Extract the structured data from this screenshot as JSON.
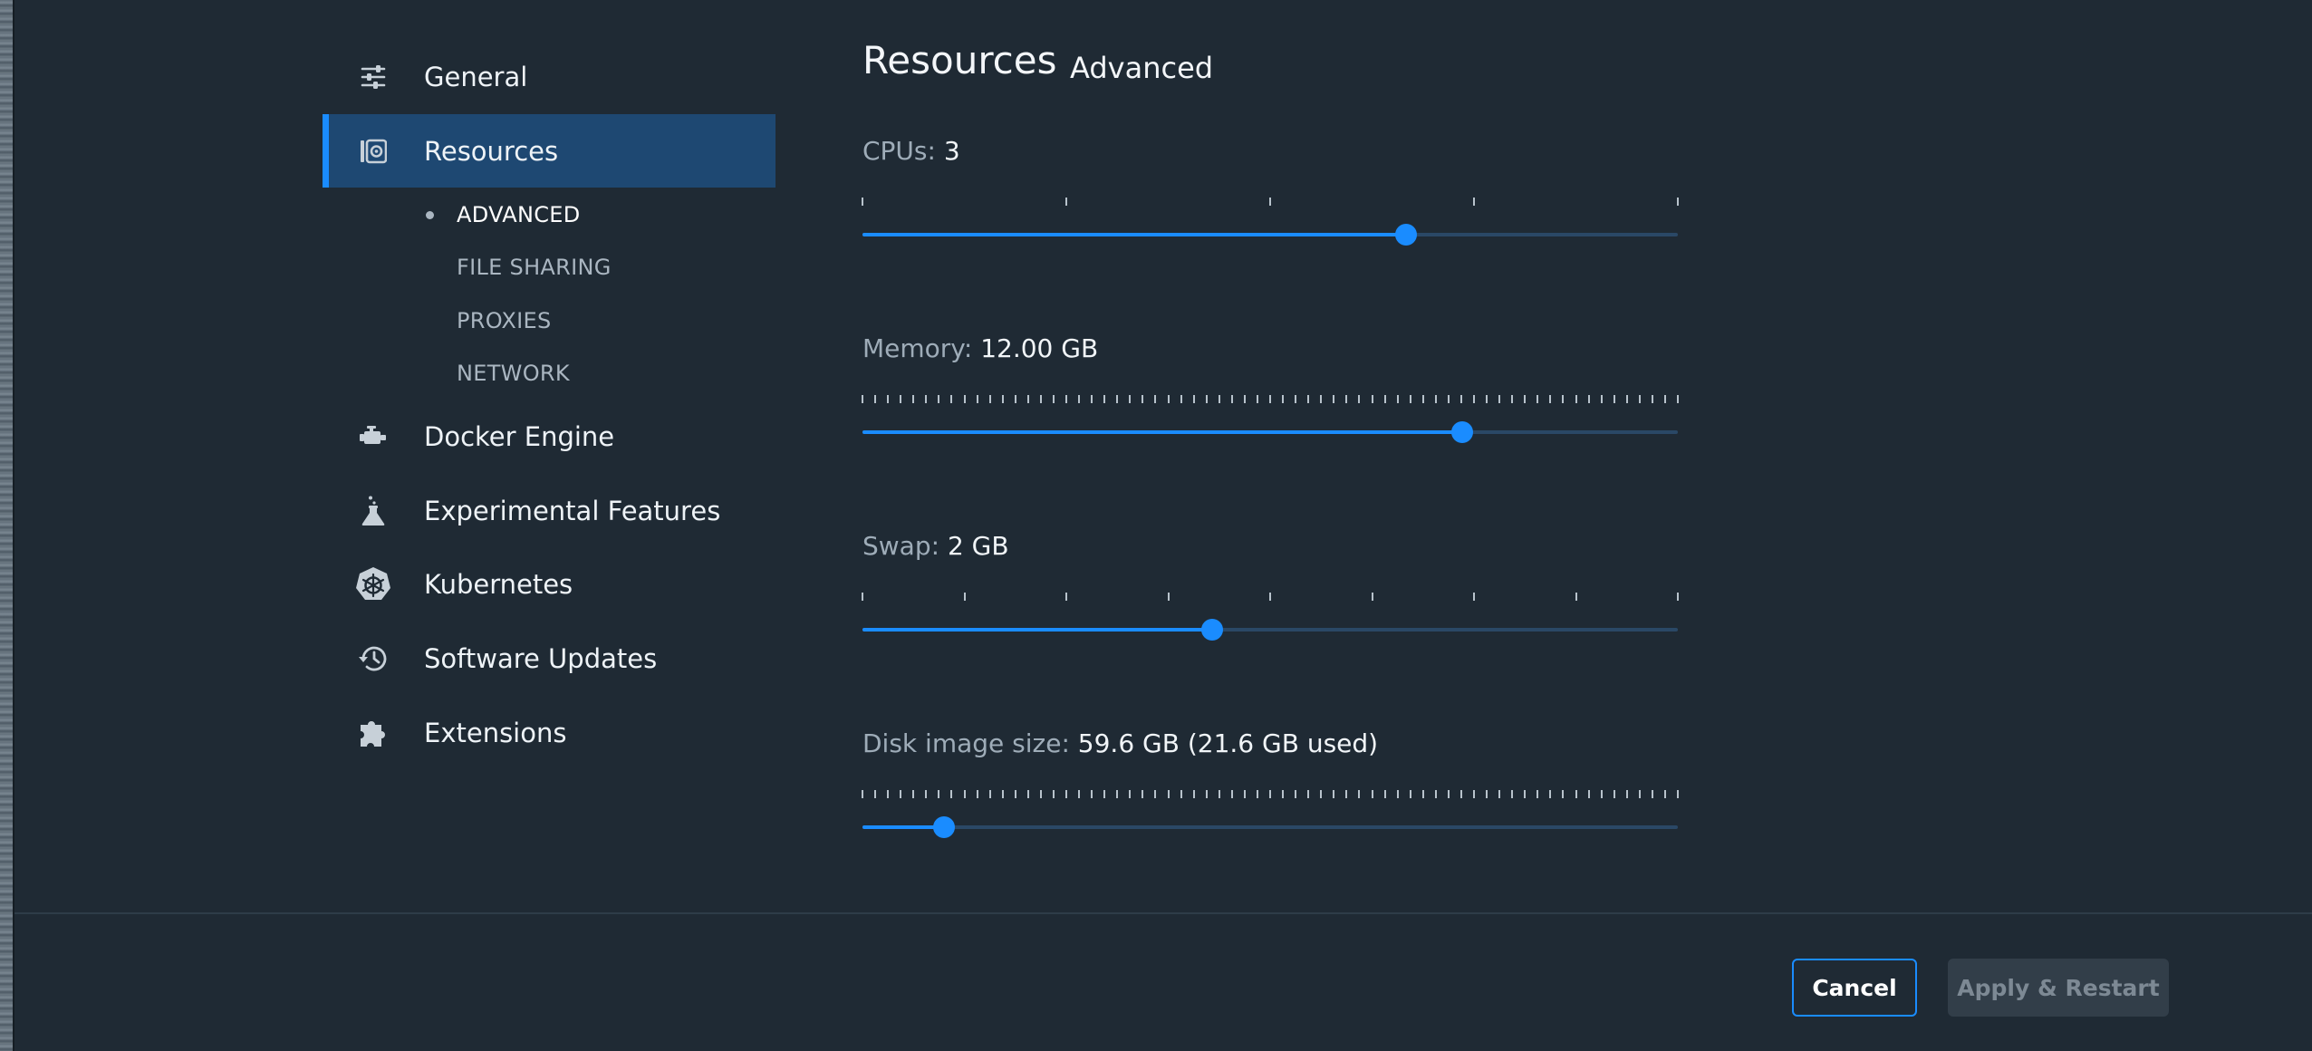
{
  "sidebar": {
    "items": [
      {
        "label": "General",
        "icon": "sliders-icon"
      },
      {
        "label": "Resources",
        "icon": "resources-icon",
        "active": true
      },
      {
        "label": "Docker Engine",
        "icon": "engine-icon"
      },
      {
        "label": "Experimental Features",
        "icon": "flask-icon"
      },
      {
        "label": "Kubernetes",
        "icon": "kubernetes-icon"
      },
      {
        "label": "Software Updates",
        "icon": "history-icon"
      },
      {
        "label": "Extensions",
        "icon": "puzzle-icon"
      }
    ],
    "sub_items": [
      {
        "label": "ADVANCED",
        "active": true
      },
      {
        "label": "FILE SHARING"
      },
      {
        "label": "PROXIES"
      },
      {
        "label": "NETWORK"
      }
    ]
  },
  "main": {
    "title": "Resources",
    "subtitle": "Advanced",
    "settings": [
      {
        "key": "CPUs:",
        "value": "3",
        "position": 0.667,
        "tick_count": 4
      },
      {
        "key": "Memory:",
        "value": "12.00 GB",
        "position": 0.735,
        "tick_count": 64
      },
      {
        "key": "Swap:",
        "value": "2 GB",
        "position": 0.429,
        "tick_count": 8
      },
      {
        "key": "Disk image size:",
        "value": "59.6 GB (21.6 GB used)",
        "position": 0.1,
        "tick_count": 64
      }
    ]
  },
  "footer": {
    "cancel_label": "Cancel",
    "apply_label": "Apply & Restart"
  },
  "colors": {
    "accent": "#1a8cff",
    "background": "#1f2a34",
    "active_nav": "#1e4872"
  }
}
